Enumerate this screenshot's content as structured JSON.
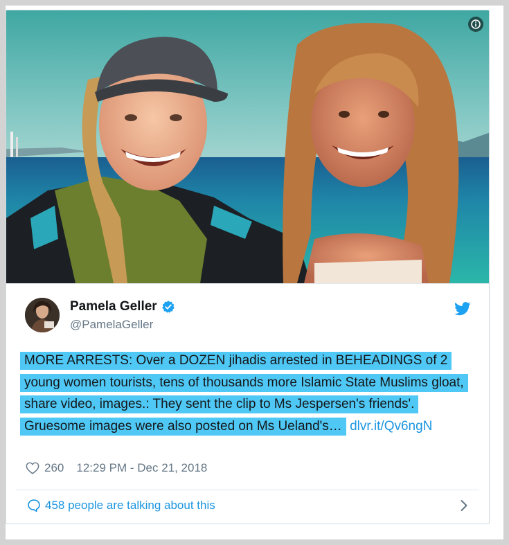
{
  "tweet": {
    "author_name": "Pamela Geller",
    "author_handle": "@PamelaGeller",
    "text_highlighted": "MORE ARRESTS: Over a DOZEN jihadis arrested in BEHEADINGS of 2 young women tourists, tens of thousands more Islamic State Muslims gloat, share video, images.: They sent the clip to Ms Jespersen's friends'. Gruesome images were also posted on Ms Ueland's…",
    "link_text": "dlvr.it/Qv6ngN",
    "likes": "260",
    "timestamp": "12:29 PM - Dec 21, 2018",
    "talking": "458 people are talking about this"
  },
  "colors": {
    "highlight": "#4fc8f5",
    "link": "#1b95e0",
    "verified": "#1da1f2",
    "muted": "#657786"
  },
  "icons": [
    "info-icon",
    "verified-badge-icon",
    "twitter-bird-icon",
    "heart-icon",
    "speech-bubble-icon",
    "chevron-right-icon"
  ]
}
